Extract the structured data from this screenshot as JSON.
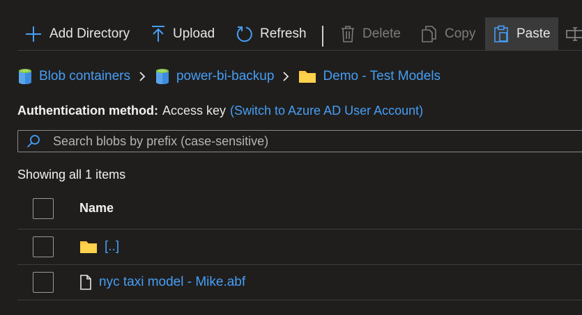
{
  "toolbar": {
    "add_directory": "Add Directory",
    "upload": "Upload",
    "refresh": "Refresh",
    "delete": "Delete",
    "copy": "Copy",
    "paste": "Paste"
  },
  "breadcrumb": {
    "items": [
      "Blob containers",
      "power-bi-backup",
      "Demo - Test Models"
    ]
  },
  "auth": {
    "label": "Authentication method:",
    "value": "Access key",
    "switch_link": "(Switch to Azure AD User Account)"
  },
  "search": {
    "placeholder": "Search blobs by prefix (case-sensitive)"
  },
  "status": {
    "count_text": "Showing all 1 items"
  },
  "table": {
    "header_name": "Name",
    "rows": [
      {
        "name": "[..]",
        "type": "folder"
      },
      {
        "name": "nyc taxi model - Mike.abf",
        "type": "file"
      }
    ]
  },
  "colors": {
    "accent": "#479ef5",
    "background": "#1f1e1d",
    "folder": "#ffc83d"
  }
}
